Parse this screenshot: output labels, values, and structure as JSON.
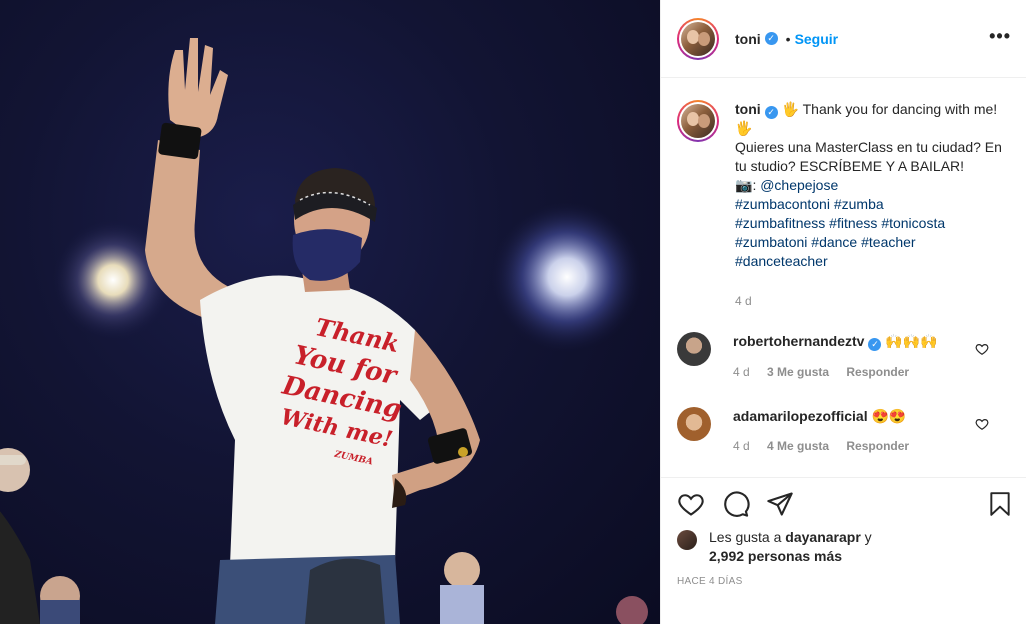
{
  "post": {
    "username": "toni",
    "follow_label": "Seguir",
    "separator": "•",
    "more_label": "•••"
  },
  "caption": {
    "username": "toni",
    "emoji_wave": "🖐",
    "line1": " Thank you for dancing with me! ",
    "line2": "Quieres una MasterClass en tu ciudad? En tu studio? ESCRÍBEME Y A BAILAR!",
    "camera_emoji": "📷",
    "mention_prefix": ": ",
    "mention": "@chepejose",
    "hashtags": [
      "#zumbacontoni",
      "#zumba",
      "#zumbafitness",
      "#fitness",
      "#tonicosta",
      "#zumbatoni",
      "#dance",
      "#teacher",
      "#danceteacher"
    ],
    "time": "4 d"
  },
  "comments": [
    {
      "username": "robertohernandeztv",
      "text": "🙌🙌🙌",
      "time": "4 d",
      "likes": "3 Me gusta",
      "reply": "Responder",
      "verified": true
    },
    {
      "username": "adamarilopezofficial",
      "text": "😍😍",
      "time": "4 d",
      "likes": "4 Me gusta",
      "reply": "Responder",
      "verified": false
    }
  ],
  "likes": {
    "prefix": "Les gusta a ",
    "user": "dayanarapr",
    "suffix": " y",
    "count": "2,992 personas más"
  },
  "posted_ago": "HACE 4 DÍAS",
  "photo": {
    "shirt_text": [
      "Thank",
      "You for",
      "Dancing",
      "With me!"
    ],
    "shirt_brand": "ZUMBA",
    "icons": {
      "heart": "heart-icon",
      "comment": "comment-icon",
      "share": "share-icon",
      "save": "bookmark-icon"
    }
  },
  "colors": {
    "follow": "#0095f6",
    "verified": "#3897f0",
    "tag": "#00376b",
    "muted": "#8e8e8e"
  }
}
